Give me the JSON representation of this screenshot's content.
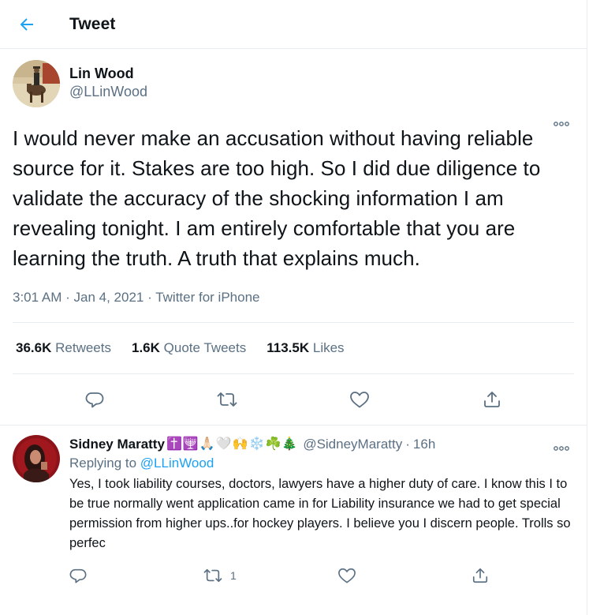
{
  "header": {
    "title": "Tweet",
    "back_icon": "arrow-left-icon",
    "accent_color": "#1da1f2"
  },
  "tweet": {
    "author": {
      "name": "Lin Wood",
      "handle": "@LLinWood"
    },
    "text": "I would never make an accusation without having reliable source for it. Stakes are too high. So I did due diligence to validate the accuracy of the shocking information I am revealing tonight. I am entirely comfortable that you are learning the truth. A truth that explains much.",
    "time": "3:01 AM",
    "date": "Jan 4, 2021",
    "source": "Twitter for iPhone",
    "separator": "·",
    "stats": {
      "retweets_count": "36.6K",
      "retweets_label": "Retweets",
      "quotes_count": "1.6K",
      "quotes_label": "Quote Tweets",
      "likes_count": "113.5K",
      "likes_label": "Likes"
    }
  },
  "reply": {
    "name": "Sidney Maratty",
    "emojis": "✝️🕎🙏🏻🤍🙌❄️☘️🎄",
    "handle": "@SidneyMaratty",
    "separator": "·",
    "time": "16h",
    "replying_prefix": "Replying to",
    "replying_to": "@LLinWood",
    "text": "Yes, I took liability courses, doctors, lawyers have a higher duty of care.  I know this I to be true normally went application came in for Liability insurance we had to get special permission from higher ups..for hockey players.  I believe you I discern people.  Trolls so perfec",
    "retweet_count": "1"
  },
  "colors": {
    "text_primary": "#0f1419",
    "text_secondary": "#5b7083",
    "link": "#1da1f2",
    "border": "#e6ecf0"
  }
}
